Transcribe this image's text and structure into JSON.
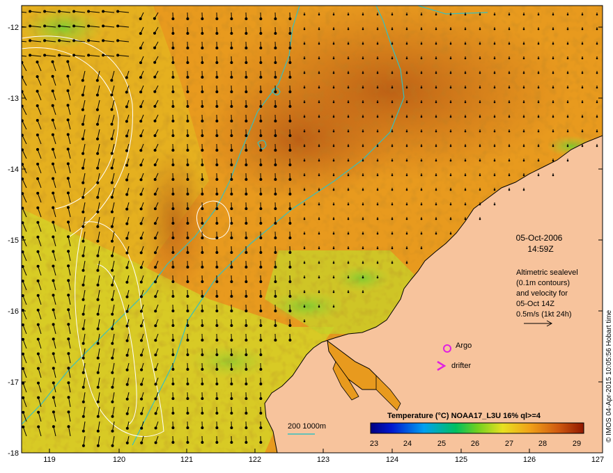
{
  "map": {
    "x_ticks": [
      "119",
      "120",
      "121",
      "122",
      "123",
      "124",
      "125",
      "126",
      "127"
    ],
    "y_ticks": [
      "-12",
      "-13",
      "-14",
      "-15",
      "-16",
      "-17",
      "-18"
    ],
    "date_line1": "05-Oct-2006",
    "date_line2": "14:59Z",
    "description_lines": [
      "Altimetric sealevel",
      "(0.1m contours)",
      "and velocity for",
      "05-Oct 14Z",
      "0.5m/s (1kt 24h)"
    ],
    "argo_label": "Argo",
    "drifter_label": "drifter",
    "depth_legend": "200  1000m",
    "colorbar_title": "Temperature (°C) NOAA17_L3U 16% ql>=4",
    "colorbar_ticks": [
      "23",
      "24",
      "25",
      "26",
      "27",
      "28",
      "29"
    ],
    "credit": "© IMOS 04-Apr-2015 10:05:56 Hobart time"
  },
  "colors": {
    "land": "#f7c39c",
    "sst_warm": "#c7681a",
    "sst_mid": "#e89a1e",
    "sst_cool": "#d9d023",
    "contour": "#35c0c0",
    "argo_marker": "#e020e0",
    "drifter_marker": "#e020e0"
  }
}
